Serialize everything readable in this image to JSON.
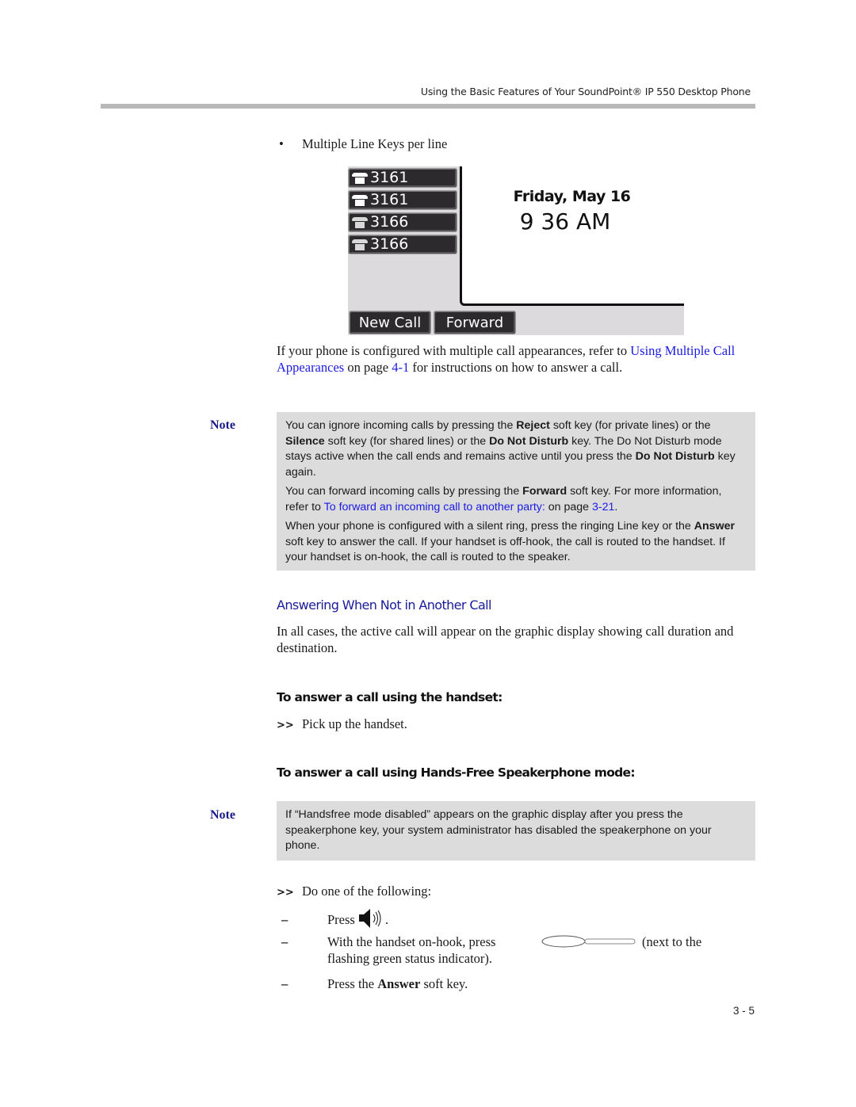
{
  "header": {
    "running_title": "Using the Basic Features of Your SoundPoint® IP 550 Desktop Phone"
  },
  "bullet": {
    "symbol": "•",
    "text": "Multiple Line Keys per line"
  },
  "phone_screen": {
    "line_keys": [
      {
        "label": "3161",
        "icon": "handset-icon"
      },
      {
        "label": "3161",
        "icon": "handset-icon"
      },
      {
        "label": "3166",
        "icon": "handset-shared-icon"
      },
      {
        "label": "3166",
        "icon": "handset-shared-icon"
      }
    ],
    "date": "Friday, May 16",
    "time": "9 36 AM",
    "soft_keys": [
      "New Call",
      "Forward"
    ]
  },
  "para1": {
    "pre": "If your phone is configured with multiple call appearances, refer to ",
    "link1": "Using Multiple Call Appearances",
    "mid": " on page ",
    "link2": "4-1",
    "post": " for instructions on how to answer a call."
  },
  "note1": {
    "label": "Note",
    "p1": {
      "a": "You can ignore incoming calls by pressing the ",
      "b1": "Reject",
      "c": " soft key (for private lines) or the ",
      "b2": "Silence",
      "d": " soft key (for shared lines) or the ",
      "b3": "Do Not Disturb",
      "e": " key. The Do Not Disturb mode stays active when the call ends and remains active until you press the ",
      "b4": "Do Not Disturb",
      "f": " key again."
    },
    "p2": {
      "a": "You can forward incoming calls by pressing the ",
      "b1": "Forward",
      "c": " soft key. For more information, refer to ",
      "link1": "To forward an incoming call to another party:",
      "d": " on page ",
      "link2": "3-21",
      "e": "."
    },
    "p3": {
      "a": "When your phone is configured with a silent ring, press the ringing Line key or the ",
      "b1": "Answer",
      "c": " soft key to answer the call. If your handset is off-hook, the call is routed to the handset. If your handset is on-hook, the call is routed to the speaker."
    }
  },
  "section": {
    "heading": "Answering When Not in Another Call",
    "intro": "In all cases, the active call will appear on the graphic display showing call duration and destination."
  },
  "handset_proc": {
    "heading": "To answer a call using the handset:",
    "step_marker": ">>",
    "step": "Pick up the handset."
  },
  "speaker_proc": {
    "heading": "To answer a call using Hands-Free Speakerphone mode:"
  },
  "note2": {
    "label": "Note",
    "text": "If “Handsfree mode disabled” appears on the graphic display after you press the speakerphone key, your system administrator has disabled the speakerphone on your phone."
  },
  "speaker_steps": {
    "step_marker": ">>",
    "step": "Do one of the following:",
    "dash": "–",
    "opt1_pre": "Press ",
    "opt1_post": ".",
    "opt2_pre": "With the handset on-hook, press",
    "opt2_post": "(next to the",
    "opt2_cont": "flashing green status indicator).",
    "opt3_pre": "Press the ",
    "opt3_bold": "Answer",
    "opt3_post": " soft key."
  },
  "footer": {
    "page_number": "3 - 5"
  }
}
